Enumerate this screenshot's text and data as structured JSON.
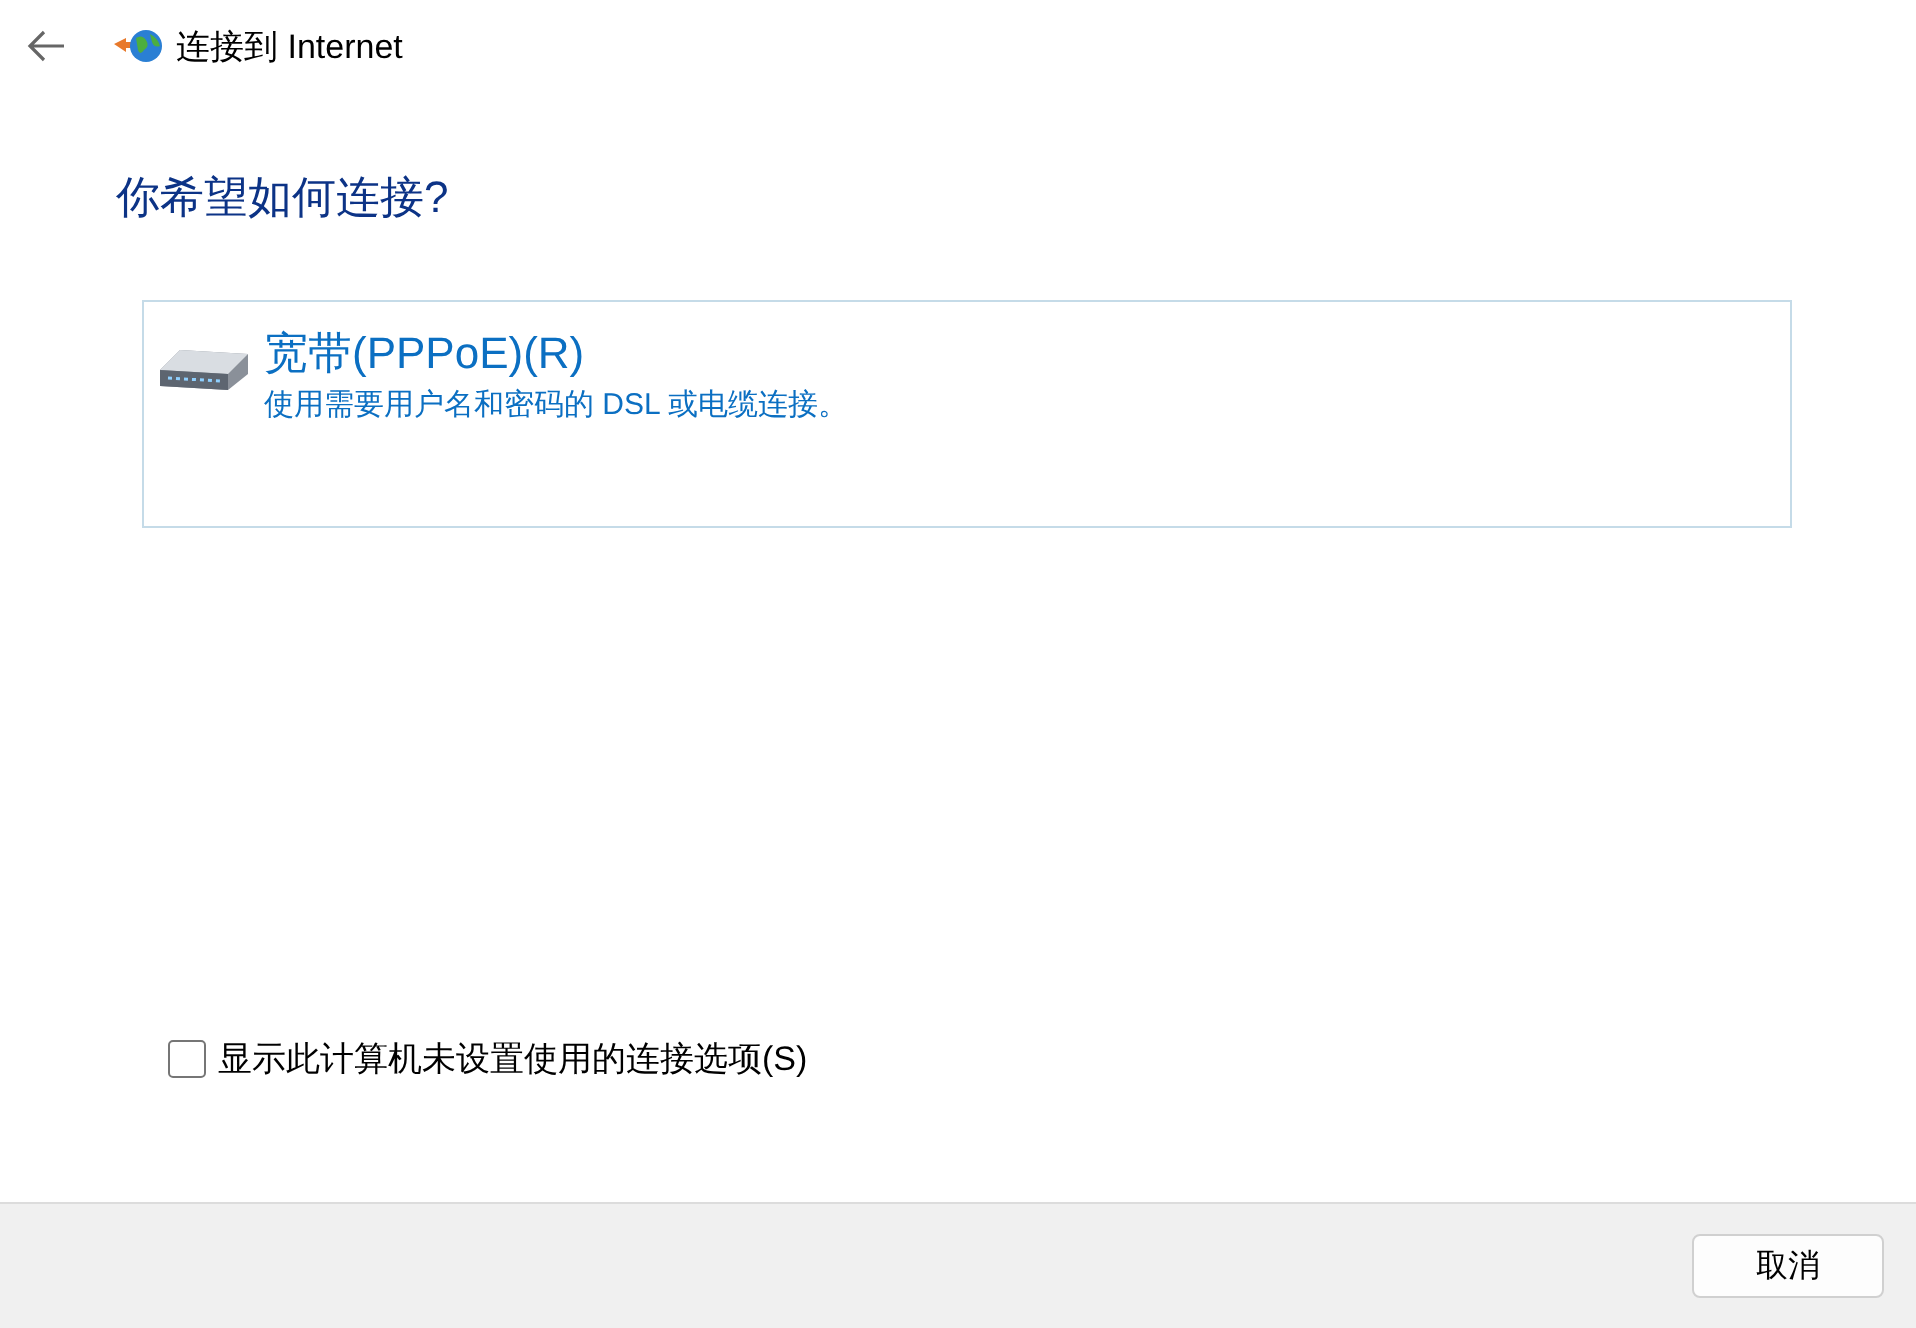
{
  "window": {
    "title": "连接到 Internet"
  },
  "heading": "你希望如何连接?",
  "options": [
    {
      "title": "宽带(PPPoE)(R)",
      "description": "使用需要用户名和密码的 DSL 或电缆连接。",
      "selected": true
    }
  ],
  "show_unconfigured": {
    "label": "显示此计算机未设置使用的连接选项(S)",
    "checked": false
  },
  "buttons": [
    "取消"
  ]
}
